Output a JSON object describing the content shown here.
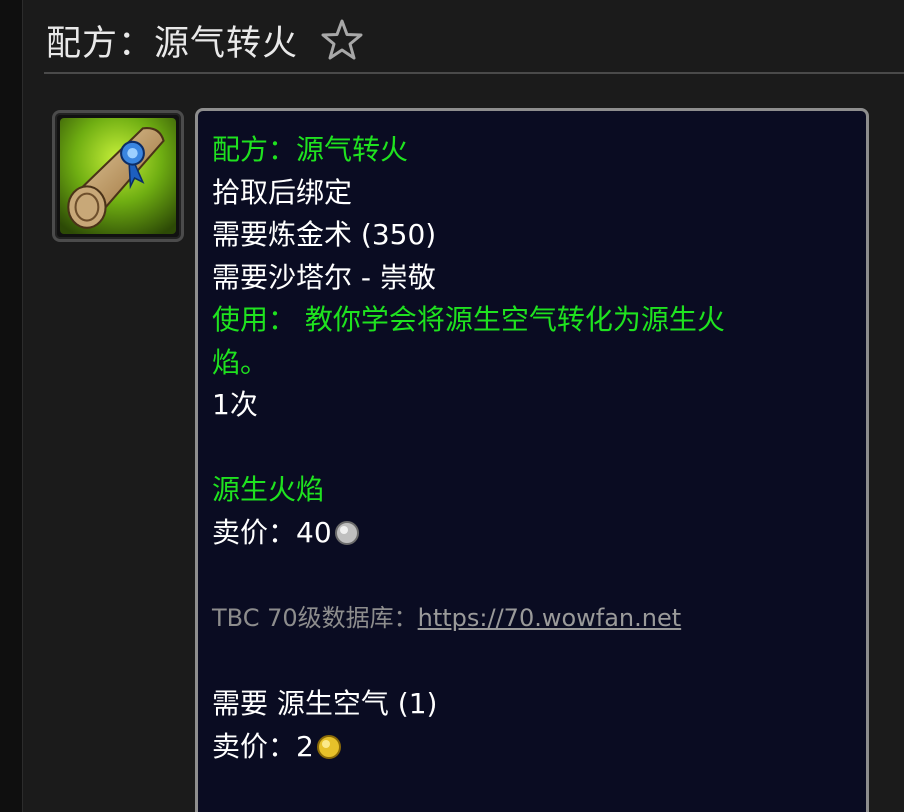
{
  "header": {
    "title": "配方：源气转火",
    "favorite_icon": "star-icon"
  },
  "item": {
    "icon": "recipe-scroll-icon",
    "name": "配方：源气转火",
    "binding": "拾取后绑定",
    "requires_skill": "需要炼金术 (350)",
    "requires_rep": "需要沙塔尔 - 崇敬",
    "use_line1": "使用： 教你学会将源生空气转化为源生火",
    "use_line2": "焰。",
    "charges": "1次",
    "reagent_result_name": "源生火焰",
    "sell_label_1": "卖价：",
    "sell_value_1": "40",
    "sell_coin_1": "silver-coin-icon",
    "db_label": "TBC 70级数据库：",
    "db_link": "https://70.wowfan.net",
    "requires_reagent": "需要 源生空气 (1)",
    "sell_label_2": "卖价：",
    "sell_value_2": "2",
    "sell_coin_2": "gold-coin-icon"
  },
  "colors": {
    "green_text": "#1fe21f",
    "tooltip_bg": "#0a0c22",
    "page_bg": "#1b1b1b"
  }
}
